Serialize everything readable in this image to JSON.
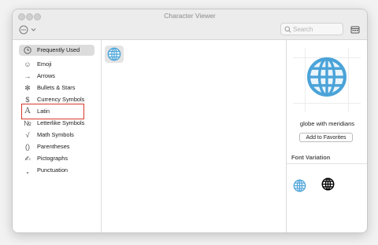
{
  "window": {
    "title": "Character Viewer"
  },
  "toolbar": {
    "search_placeholder": "Search"
  },
  "sidebar": {
    "items": [
      {
        "label": "Frequently Used",
        "icon": "clock-icon",
        "glyph": "🕘"
      },
      {
        "label": "Emoji",
        "icon": "smiley-icon",
        "glyph": "☺"
      },
      {
        "label": "Arrows",
        "icon": "arrow-icon",
        "glyph": "→"
      },
      {
        "label": "Bullets & Stars",
        "icon": "asterisk-icon",
        "glyph": "✻"
      },
      {
        "label": "Currency Symbols",
        "icon": "dollar-icon",
        "glyph": "$"
      },
      {
        "label": "Latin",
        "icon": "latin-a-icon",
        "glyph": "A"
      },
      {
        "label": "Letterlike Symbols",
        "icon": "numero-icon",
        "glyph": "№"
      },
      {
        "label": "Math Symbols",
        "icon": "sqrt-icon",
        "glyph": "√"
      },
      {
        "label": "Parentheses",
        "icon": "parentheses-icon",
        "glyph": "()"
      },
      {
        "label": "Pictographs",
        "icon": "pictograph-icon",
        "glyph": "✍"
      },
      {
        "label": "Punctuation",
        "icon": "punctuation-icon",
        "glyph": "„"
      }
    ],
    "selected_index": 0
  },
  "inspector": {
    "character_name": "globe with meridians",
    "add_favorites_label": "Add to Favorites",
    "font_variation_title": "Font Variation"
  },
  "colors": {
    "selection_bg": "#dcdcdc",
    "highlight_border": "#d9382b",
    "globe_blue": "#4aa3d8"
  }
}
